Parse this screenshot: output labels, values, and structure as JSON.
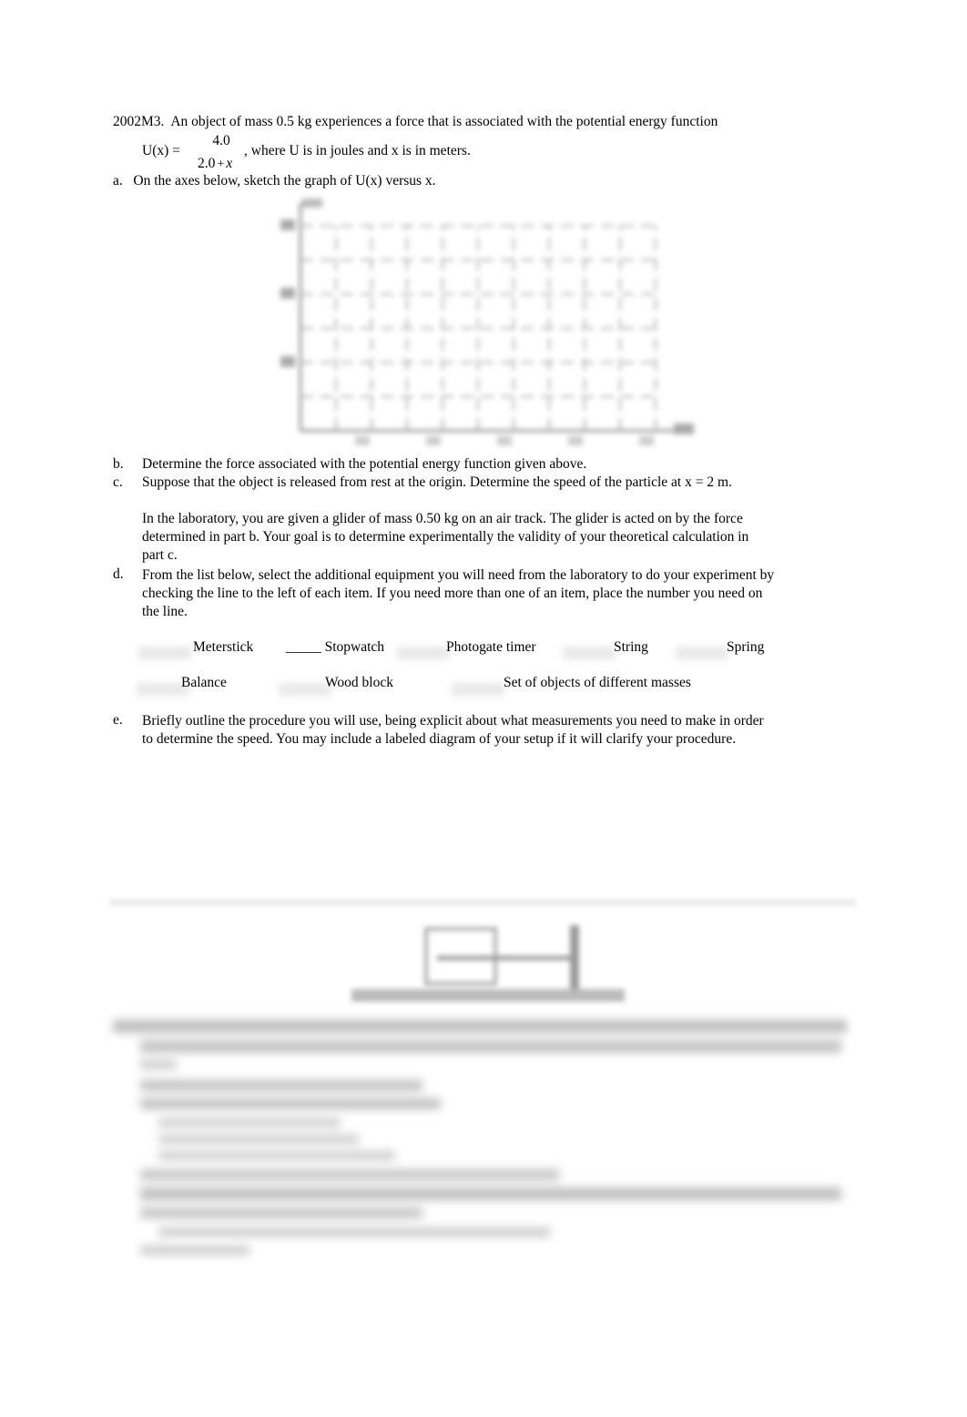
{
  "problem": {
    "id": "2002M3.",
    "intro": "An object of mass 0.5 kg experiences a force that is associated with the potential energy function",
    "equation_lhs": "U(x) =",
    "numerator": "4.0",
    "denominator_const": "2.0",
    "denominator_op": "+",
    "denominator_var": "x",
    "equation_tail": ", where U is in joules and x is in meters."
  },
  "parts": {
    "a": {
      "label": "a.",
      "text": "On the axes below, sketch the graph of U(x) versus x."
    },
    "b": {
      "label": "b.",
      "text": "Determine the force associated with the potential energy function given above."
    },
    "c": {
      "label": "c.",
      "text": "Suppose that the object is released from rest at the origin.  Determine the speed of the particle at x = 2 m."
    },
    "lab_intro_1": "In the laboratory, you are given a glider of mass 0.50 kg on an air track. The glider is acted on by the force",
    "lab_intro_2": "determined in part b.   Your goal is to determine experimentally the validity of your theoretical calculation in",
    "lab_intro_3": "part c.",
    "d": {
      "label": "d.",
      "line1": "From the list below, select the additional equipment you will need from the laboratory to do your experiment by",
      "line2": "checking the line to the left of each item.  If you need more than one of an item, place the number you need on",
      "line3": "the line."
    },
    "e": {
      "label": "e.",
      "line1": "Briefly outline the procedure you will use, being explicit about what measurements you need to make in order",
      "line2": "to determine the speed. You may include a labeled diagram of your setup if it will clarify your procedure."
    }
  },
  "equipment": {
    "row1": [
      "Meterstick",
      "Stopwatch",
      "Photogate timer",
      "String",
      "Spring"
    ],
    "row2": [
      "Balance",
      "Wood block",
      "Set of objects of different masses"
    ],
    "stopwatch_blank": "_____"
  },
  "chart_data": {
    "type": "line",
    "title": "",
    "xlabel": "",
    "ylabel": "",
    "grid": true,
    "note": "Blank axes with grid for sketching; tick labels are illegible (blurred). No plotted data.",
    "series": []
  },
  "blurred_section": {
    "description": "Lower portion of page (next problem with diagram) is obscured and unreadable"
  }
}
